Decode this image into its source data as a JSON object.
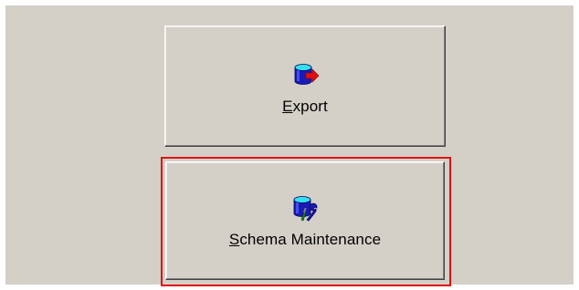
{
  "buttons": {
    "export": {
      "mnemonic": "E",
      "rest": "xport",
      "icon": "database-export-icon"
    },
    "schema_maintenance": {
      "mnemonic": "S",
      "rest": "chema Maintenance",
      "icon": "database-wrench-icon",
      "highlighted": true
    }
  },
  "colors": {
    "panel_bg": "#d4d0c8",
    "highlight": "#e01010",
    "db_blue": "#1a1ab4",
    "db_top": "#33e0f0",
    "arrow_red": "#e01010"
  }
}
